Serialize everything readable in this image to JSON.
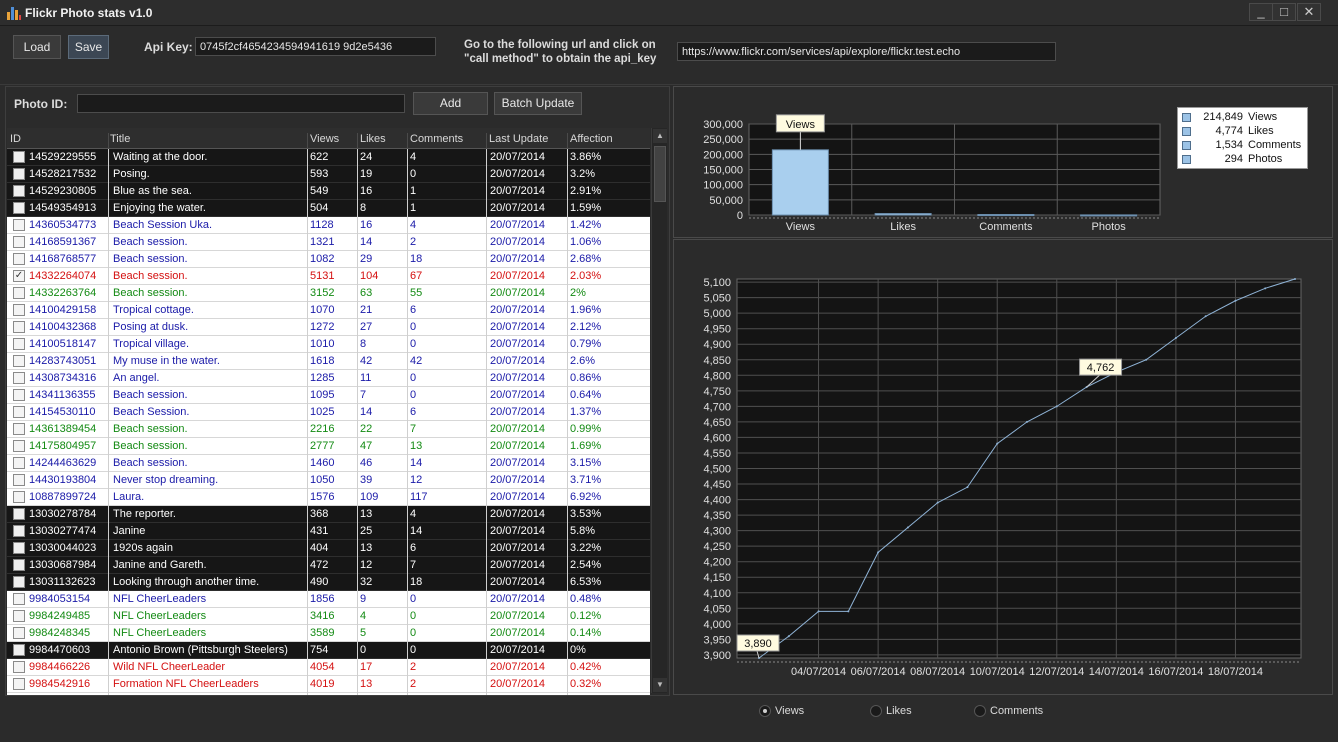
{
  "window": {
    "title": "Flickr Photo stats v1.0",
    "controls": [
      "_",
      "□",
      "✕"
    ]
  },
  "toolbar": {
    "load_label": "Load",
    "save_label": "Save",
    "apikey_label": "Api Key:",
    "apikey_value": "0745f2cf4654234594941619 9d2e5436",
    "hint_line1": "Go to the following url and click on",
    "hint_line2": "\"call method\" to obtain the api_key",
    "url_value": "https://www.flickr.com/services/api/explore/flickr.test.echo"
  },
  "photo": {
    "id_label": "Photo ID:",
    "id_value": "",
    "add_label": "Add",
    "batch_label": "Batch Update"
  },
  "table": {
    "headers": [
      "ID",
      "Title",
      "Views",
      "Likes",
      "Comments",
      "Last Update",
      "Affection"
    ],
    "rows": [
      {
        "checked": false,
        "style": "dark",
        "cells": [
          "14529229555",
          "Waiting at the door.",
          "622",
          "24",
          "4",
          "20/07/2014",
          "3.86%"
        ]
      },
      {
        "checked": false,
        "style": "dark",
        "cells": [
          "14528217532",
          "Posing.",
          "593",
          "19",
          "0",
          "20/07/2014",
          "3.2%"
        ]
      },
      {
        "checked": false,
        "style": "dark",
        "cells": [
          "14529230805",
          "Blue as the sea.",
          "549",
          "16",
          "1",
          "20/07/2014",
          "2.91%"
        ]
      },
      {
        "checked": false,
        "style": "dark",
        "cells": [
          "14549354913",
          "Enjoying the water.",
          "504",
          "8",
          "1",
          "20/07/2014",
          "1.59%"
        ]
      },
      {
        "checked": false,
        "style": "blue",
        "cells": [
          "14360534773",
          "Beach Session Uka.",
          "1128",
          "16",
          "4",
          "20/07/2014",
          "1.42%"
        ]
      },
      {
        "checked": false,
        "style": "blue",
        "cells": [
          "14168591367",
          "Beach session.",
          "1321",
          "14",
          "2",
          "20/07/2014",
          "1.06%"
        ]
      },
      {
        "checked": false,
        "style": "blue",
        "cells": [
          "14168768577",
          "Beach session.",
          "1082",
          "29",
          "18",
          "20/07/2014",
          "2.68%"
        ]
      },
      {
        "checked": true,
        "style": "red",
        "cells": [
          "14332264074",
          "Beach session.",
          "5131",
          "104",
          "67",
          "20/07/2014",
          "2.03%"
        ]
      },
      {
        "checked": false,
        "style": "green",
        "cells": [
          "14332263764",
          "Beach session.",
          "3152",
          "63",
          "55",
          "20/07/2014",
          "2%"
        ]
      },
      {
        "checked": false,
        "style": "blue",
        "cells": [
          "14100429158",
          "Tropical cottage.",
          "1070",
          "21",
          "6",
          "20/07/2014",
          "1.96%"
        ]
      },
      {
        "checked": false,
        "style": "blue",
        "cells": [
          "14100432368",
          "Posing at dusk.",
          "1272",
          "27",
          "0",
          "20/07/2014",
          "2.12%"
        ]
      },
      {
        "checked": false,
        "style": "blue",
        "cells": [
          "14100518147",
          "Tropical village.",
          "1010",
          "8",
          "0",
          "20/07/2014",
          "0.79%"
        ]
      },
      {
        "checked": false,
        "style": "blue",
        "cells": [
          "14283743051",
          "My muse in the water.",
          "1618",
          "42",
          "42",
          "20/07/2014",
          "2.6%"
        ]
      },
      {
        "checked": false,
        "style": "blue",
        "cells": [
          "14308734316",
          "An angel.",
          "1285",
          "11",
          "0",
          "20/07/2014",
          "0.86%"
        ]
      },
      {
        "checked": false,
        "style": "blue",
        "cells": [
          "14341136355",
          "Beach session.",
          "1095",
          "7",
          "0",
          "20/07/2014",
          "0.64%"
        ]
      },
      {
        "checked": false,
        "style": "blue",
        "cells": [
          "14154530110",
          "Beach Session.",
          "1025",
          "14",
          "6",
          "20/07/2014",
          "1.37%"
        ]
      },
      {
        "checked": false,
        "style": "green",
        "cells": [
          "14361389454",
          "Beach session.",
          "2216",
          "22",
          "7",
          "20/07/2014",
          "0.99%"
        ]
      },
      {
        "checked": false,
        "style": "green",
        "cells": [
          "14175804957",
          "Beach session.",
          "2777",
          "47",
          "13",
          "20/07/2014",
          "1.69%"
        ]
      },
      {
        "checked": false,
        "style": "blue",
        "cells": [
          "14244463629",
          "Beach session.",
          "1460",
          "46",
          "14",
          "20/07/2014",
          "3.15%"
        ]
      },
      {
        "checked": false,
        "style": "blue",
        "cells": [
          "14430193804",
          "Never stop dreaming.",
          "1050",
          "39",
          "12",
          "20/07/2014",
          "3.71%"
        ]
      },
      {
        "checked": false,
        "style": "blue",
        "cells": [
          "10887899724",
          "Laura.",
          "1576",
          "109",
          "117",
          "20/07/2014",
          "6.92%"
        ]
      },
      {
        "checked": false,
        "style": "dark",
        "cells": [
          "13030278784",
          "The reporter.",
          "368",
          "13",
          "4",
          "20/07/2014",
          "3.53%"
        ]
      },
      {
        "checked": false,
        "style": "dark",
        "cells": [
          "13030277474",
          "Janine",
          "431",
          "25",
          "14",
          "20/07/2014",
          "5.8%"
        ]
      },
      {
        "checked": false,
        "style": "dark",
        "cells": [
          "13030044023",
          "1920s again",
          "404",
          "13",
          "6",
          "20/07/2014",
          "3.22%"
        ]
      },
      {
        "checked": false,
        "style": "dark",
        "cells": [
          "13030687984",
          "Janine and Gareth.",
          "472",
          "12",
          "7",
          "20/07/2014",
          "2.54%"
        ]
      },
      {
        "checked": false,
        "style": "dark",
        "cells": [
          "13031132623",
          "Looking through another time.",
          "490",
          "32",
          "18",
          "20/07/2014",
          "6.53%"
        ]
      },
      {
        "checked": false,
        "style": "blue",
        "cells": [
          "9984053154",
          "NFL CheerLeaders",
          "1856",
          "9",
          "0",
          "20/07/2014",
          "0.48%"
        ]
      },
      {
        "checked": false,
        "style": "green",
        "cells": [
          "9984249485",
          "NFL CheerLeaders",
          "3416",
          "4",
          "0",
          "20/07/2014",
          "0.12%"
        ]
      },
      {
        "checked": false,
        "style": "green",
        "cells": [
          "9984248345",
          "NFL CheerLeaders",
          "3589",
          "5",
          "0",
          "20/07/2014",
          "0.14%"
        ]
      },
      {
        "checked": false,
        "style": "dark",
        "cells": [
          "9984470603",
          "Antonio Brown (Pittsburgh Steelers)",
          "754",
          "0",
          "0",
          "20/07/2014",
          "0%"
        ]
      },
      {
        "checked": false,
        "style": "red",
        "cells": [
          "9984466226",
          "Wild NFL CheerLeader",
          "4054",
          "17",
          "2",
          "20/07/2014",
          "0.42%"
        ]
      },
      {
        "checked": false,
        "style": "red",
        "cells": [
          "9984542916",
          "Formation NFL CheerLeaders",
          "4019",
          "13",
          "2",
          "20/07/2014",
          "0.32%"
        ]
      }
    ]
  },
  "legend": [
    {
      "value": "214,849",
      "name": "Views"
    },
    {
      "value": "4,774",
      "name": "Likes"
    },
    {
      "value": "1,534",
      "name": "Comments"
    },
    {
      "value": "294",
      "name": "Photos"
    }
  ],
  "radios": {
    "selected": "Views",
    "options": [
      "Views",
      "Likes",
      "Comments"
    ]
  },
  "colors": {
    "bar_fill": "#a9cfee",
    "line": "#8fb3d6",
    "dark_row": "#161616",
    "blue_text": "#1a1aa8",
    "red_text": "#d41010",
    "green_text": "#138a13"
  },
  "chart_data": [
    {
      "type": "bar",
      "categories": [
        "Views",
        "Likes",
        "Comments",
        "Photos"
      ],
      "values": [
        214849,
        4774,
        1534,
        294
      ],
      "ylim": [
        0,
        300000
      ],
      "yticks": [
        "0",
        "50,000",
        "100,000",
        "150,000",
        "200,000",
        "250,000",
        "300,000"
      ],
      "ytick_values": [
        0,
        50000,
        100000,
        150000,
        200000,
        250000,
        300000
      ],
      "tooltip": "Views",
      "grid": true,
      "legend_position": "right"
    },
    {
      "type": "line",
      "x": [
        "02/07/2014",
        "03/07/2014",
        "04/07/2014",
        "05/07/2014",
        "06/07/2014",
        "07/07/2014",
        "08/07/2014",
        "09/07/2014",
        "10/07/2014",
        "11/07/2014",
        "12/07/2014",
        "13/07/2014",
        "14/07/2014",
        "15/07/2014",
        "16/07/2014",
        "17/07/2014",
        "18/07/2014",
        "19/07/2014",
        "20/07/2014"
      ],
      "values": [
        3890,
        3960,
        4040,
        4040,
        4230,
        4310,
        4390,
        4440,
        4580,
        4650,
        4700,
        4762,
        4810,
        4850,
        4920,
        4990,
        5040,
        5080,
        5110
      ],
      "xticks": [
        "04/07/2014",
        "06/07/2014",
        "08/07/2014",
        "10/07/2014",
        "12/07/2014",
        "14/07/2014",
        "16/07/2014",
        "18/07/2014"
      ],
      "ylim": [
        3890,
        5110
      ],
      "yticks": [
        "3,900",
        "3,950",
        "4,000",
        "4,050",
        "4,100",
        "4,150",
        "4,200",
        "4,250",
        "4,300",
        "4,350",
        "4,400",
        "4,450",
        "4,500",
        "4,550",
        "4,600",
        "4,650",
        "4,700",
        "4,750",
        "4,800",
        "4,850",
        "4,900",
        "4,950",
        "5,000",
        "5,050",
        "5,100"
      ],
      "ytick_values": [
        3900,
        3950,
        4000,
        4050,
        4100,
        4150,
        4200,
        4250,
        4300,
        4350,
        4400,
        4450,
        4500,
        4550,
        4600,
        4650,
        4700,
        4750,
        4800,
        4850,
        4900,
        4950,
        5000,
        5050,
        5100
      ],
      "annotations": [
        "3,890",
        "4,762"
      ],
      "annotation_values": [
        3890,
        4762
      ],
      "grid": true
    }
  ]
}
